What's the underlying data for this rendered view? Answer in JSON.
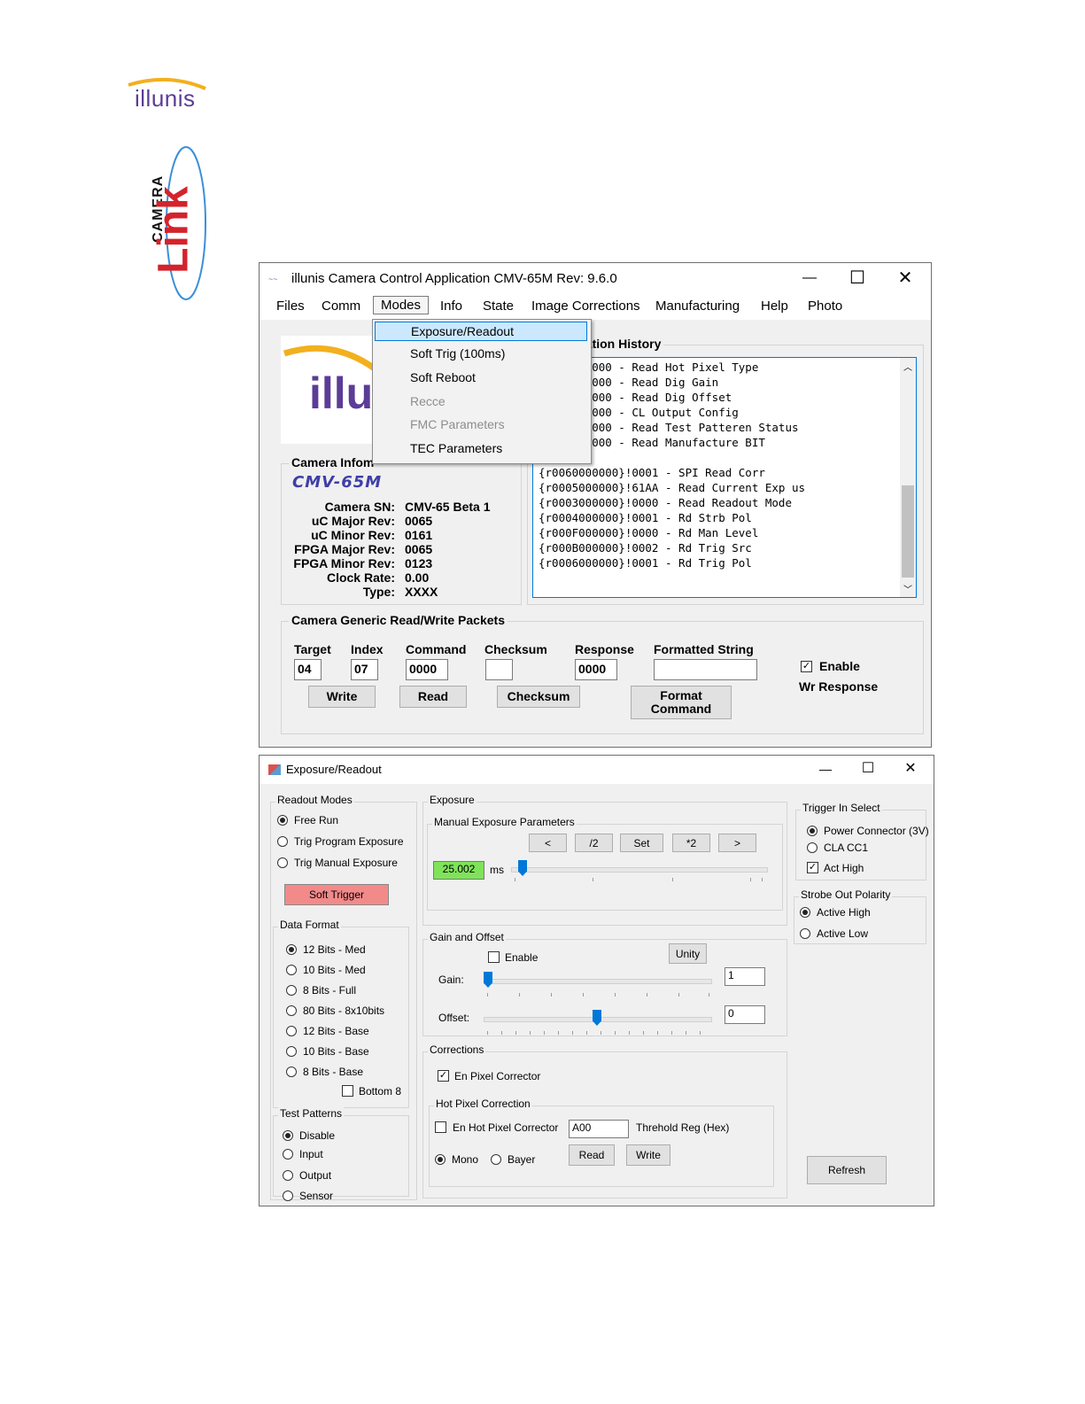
{
  "logos": {
    "illunis_text": "illunis",
    "camera_link_text": "CAMERA",
    "link_text": "Link"
  },
  "main_window": {
    "title": "illunis Camera Control Application CMV-65M  Rev: 9.6.0",
    "controls": {
      "minimize": "—",
      "maximize": "☐",
      "close": "✕"
    },
    "menu": [
      "Files",
      "Comm",
      "Modes",
      "Info",
      "State",
      "Image Corrections",
      "Manufacturing",
      "Help",
      "Photo"
    ],
    "modes_dropdown": [
      {
        "label": "Exposure/Readout",
        "enabled": true,
        "highlighted": true
      },
      {
        "label": "Soft Trig (100ms)",
        "enabled": true
      },
      {
        "label": "Soft Reboot",
        "enabled": true
      },
      {
        "label": "Recce",
        "enabled": false
      },
      {
        "label": "FMC Parameters",
        "enabled": false
      },
      {
        "label": "TEC Parameters",
        "enabled": true
      }
    ],
    "logo_text": "illu",
    "camera_info": {
      "title": "Camera Infom",
      "model": "CMV-65M",
      "rows": [
        {
          "label": "Camera SN:",
          "value": "CMV-65 Beta 1"
        },
        {
          "label": "uC Major Rev:",
          "value": "0065"
        },
        {
          "label": "uC Minor Rev:",
          "value": "0161"
        },
        {
          "label": "FPGA Major Rev:",
          "value": "0065"
        },
        {
          "label": "FPGA Minor Rev:",
          "value": "0123"
        },
        {
          "label": "Clock Rate:",
          "value": "0.00"
        },
        {
          "label": "Type:",
          "value": "XXXX"
        }
      ]
    },
    "history": {
      "title": "cation History",
      "lines": [
        "00000}!0000 - Read Hot Pixel Type",
        "00000}!0000 - Read Dig Gain",
        "00000}!0000 - Read Dig Offset",
        "00000}!0000 - CL Output Config",
        "00000}!0000 - Read Test Patteren Status",
        "00000}!0000 - Read Manufacture BIT",
        "",
        "{r0060000000}!0001 - SPI Read Corr",
        "{r0005000000}!61AA - Read Current Exp us",
        "{r0003000000}!0000 - Read Readout Mode",
        "{r0004000000}!0001 - Rd Strb Pol",
        "{r000F000000}!0000 - Rd Man Level",
        "{r000B000000}!0002 - Rd Trig Src",
        "{r0006000000}!0001 - Rd Trig Pol"
      ]
    },
    "packets": {
      "title": "Camera Generic Read/Write Packets",
      "headers": {
        "target": "Target",
        "index": "Index",
        "command": "Command",
        "checksum": "Checksum",
        "response": "Response",
        "formatted": "Formatted String"
      },
      "values": {
        "target": "04",
        "index": "07",
        "command": "0000",
        "checksum": "",
        "response": "0000",
        "formatted": ""
      },
      "buttons": {
        "write": "Write",
        "read": "Read",
        "checksum": "Checksum",
        "format": "Format Command"
      },
      "enable_label": "Enable",
      "wr_response_label": "Wr Response",
      "enable_checked": true
    }
  },
  "exposure_window": {
    "title": "Exposure/Readout",
    "controls": {
      "minimize": "—",
      "maximize": "☐",
      "close": "✕"
    },
    "readout_modes": {
      "title": "Readout Modes",
      "options": [
        "Free Run",
        "Trig Program Exposure",
        "Trig Manual Exposure"
      ],
      "selected": 0,
      "soft_trigger": "Soft Trigger"
    },
    "data_format": {
      "title": "Data Format",
      "options": [
        "12 Bits - Med",
        "10 Bits - Med",
        "8 Bits - Full",
        "80 Bits - 8x10bits",
        "12 Bits - Base",
        "10 Bits - Base",
        "8 Bits - Base"
      ],
      "selected": 0,
      "bottom8_label": "Bottom 8"
    },
    "test_patterns": {
      "title": "Test Patterns",
      "options": [
        "Disable",
        "Input",
        "Output",
        "Sensor"
      ],
      "selected": 0
    },
    "exposure": {
      "title": "Exposure",
      "manual_title": "Manual Exposure Parameters",
      "buttons": [
        "<",
        "/2",
        "Set",
        "*2",
        ">"
      ],
      "value": "25.002",
      "unit": "ms",
      "slider_level": 0.03
    },
    "gain_offset": {
      "title": "Gain and Offset",
      "enable_label": "Enable",
      "unity_label": "Unity",
      "gain_label": "Gain:",
      "gain_value": "1",
      "gain_level": 0.0,
      "offset_label": "Offset:",
      "offset_value": "0",
      "offset_level": 0.5
    },
    "corrections": {
      "title": "Corrections",
      "en_pixel_label": "En Pixel Corrector",
      "en_pixel_checked": true,
      "hot_pixel_title": "Hot Pixel Correction",
      "en_hot_pixel_label": "En Hot Pixel Corrector",
      "threshold_value": "A00",
      "threshold_label": "Threhold Reg (Hex)",
      "mono_label": "Mono",
      "bayer_label": "Bayer",
      "read_label": "Read",
      "write_label": "Write"
    },
    "trigger_in": {
      "title": "Trigger In Select",
      "options": [
        "Power Connector (3V)",
        "CLA CC1"
      ],
      "selected": 0,
      "act_high_label": "Act High",
      "act_high_checked": true
    },
    "strobe": {
      "title": "Strobe Out Polarity",
      "options": [
        "Active High",
        "Active Low"
      ],
      "selected": 0
    },
    "refresh_label": "Refresh"
  }
}
